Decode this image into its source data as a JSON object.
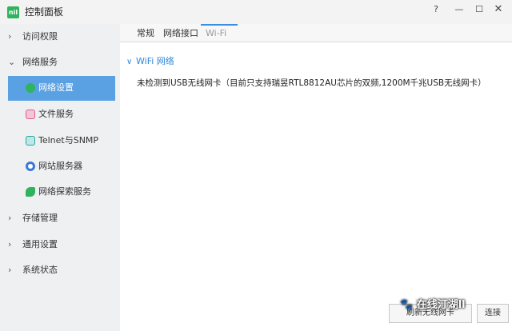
{
  "window": {
    "title": "控制面板",
    "logo_text": "nil",
    "controls": {
      "help": "?",
      "minimize": "—",
      "maximize": "☐",
      "close": "✕"
    }
  },
  "sidebar": {
    "groups": [
      {
        "label": "访问权限",
        "expanded": false
      },
      {
        "label": "网络服务",
        "expanded": true
      },
      {
        "label": "存储管理",
        "expanded": false
      },
      {
        "label": "通用设置",
        "expanded": false
      },
      {
        "label": "系统状态",
        "expanded": false
      }
    ],
    "network_items": [
      {
        "label": "网络设置",
        "icon": "globe-icon",
        "color": "#2fb35d",
        "active": true
      },
      {
        "label": "文件服务",
        "icon": "file-service-icon",
        "color": "#e05c8a",
        "active": false
      },
      {
        "label": "Telnet与SNMP",
        "icon": "terminal-icon",
        "color": "#2aa5a0",
        "active": false
      },
      {
        "label": "网站服务器",
        "icon": "web-server-icon",
        "color": "#3b78d8",
        "active": false
      },
      {
        "label": "网络探索服务",
        "icon": "discovery-icon",
        "color": "#2fb35d",
        "active": false
      }
    ]
  },
  "tabs": [
    {
      "label": "常规",
      "active": false
    },
    {
      "label": "网络接口",
      "active": false
    },
    {
      "label": "Wi-Fi",
      "active": true
    }
  ],
  "section": {
    "title": "WiFi 网络",
    "message": "未检测到USB无线网卡（目前只支持瑞昱RTL8812AU芯片的双频,1200M千兆USB无线网卡）"
  },
  "footer": {
    "primary_button": "刷新无线网卡",
    "secondary_button": "连接"
  },
  "watermark": "🐾 在线汀湖ll",
  "colors": {
    "accent": "#5aa1e3",
    "link": "#2d86d9",
    "brand": "#2fb35d"
  }
}
